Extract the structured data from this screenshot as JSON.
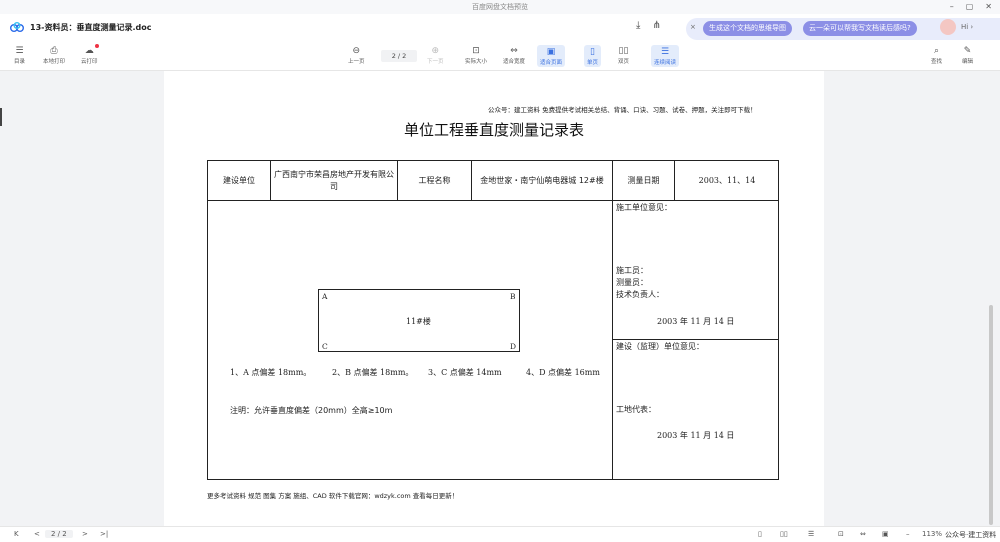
{
  "window": {
    "title": "百度网盘文档预览",
    "controls": [
      "–",
      "▢",
      "✕"
    ]
  },
  "header": {
    "filename": "13-资料员：垂直度测量记录.doc",
    "download_icon": "download-icon",
    "share_icon": "share-icon"
  },
  "ai": {
    "close": "×",
    "chip1": "生成这个文档的思维导图",
    "chip2": "云一朵可以帮我写文档读后感吗?",
    "hi": "Hi ›"
  },
  "toolbar": {
    "left": [
      {
        "icon": "☰",
        "label": "目录"
      },
      {
        "icon": "⎙",
        "label": "本地打印"
      },
      {
        "icon": "☁",
        "label": "云打印"
      }
    ],
    "prev": "上一页",
    "page": "2 / 2",
    "next": "下一页",
    "actual_size": "实际大小",
    "fit_width": "适合宽度",
    "fit_page": "适合页面",
    "single": "单页",
    "double": "双页",
    "continuous": "连续阅读",
    "search": "查找",
    "edit": "编辑"
  },
  "doc": {
    "publisher": "公众号：建工资料 免费提供考试相关总结、背诵、口诀、习题、试卷、押题，关注即可下载！",
    "title": "单位工程垂直度测量记录表",
    "row1": {
      "c1": "建设单位",
      "c2": "广西南宁市荣昌房地产开发有限公司",
      "c3": "工程名称",
      "c4": "金地世家・南宁仙萌电器城 12#楼",
      "c5": "测量日期",
      "c6": "2003、11、14"
    },
    "corners": {
      "a": "A",
      "b": "B",
      "c": "C",
      "d": "D"
    },
    "building": "11#楼",
    "deviations": [
      "1、A 点偏差 18mm。",
      "2、B 点偏差 18mm。",
      "3、C 点偏差 14mm",
      "4、D 点偏差 16mm"
    ],
    "note": "注明：允许垂直度偏差（20mm）全高≥10m",
    "construction": {
      "opinion": "施工单位意见：",
      "worker": "施工员：",
      "surveyor": "测量员：",
      "tech": "技术负责人：",
      "date": "2003 年 11 月 14 日"
    },
    "supervision": {
      "opinion": "建设（监理）单位意见：",
      "rep": "工地代表：",
      "date": "2003 年 11 月 14 日"
    },
    "footer": "更多考试资料 规范 图集 方案 施组、CAD 软件下载官网：wdzyk.com 查看每日更新！"
  },
  "status": {
    "first": "K",
    "prev": "<",
    "page": "2 / 2",
    "next": ">",
    "last": ">|",
    "zoom": "113%",
    "watermark": "公众号·建工资料"
  }
}
